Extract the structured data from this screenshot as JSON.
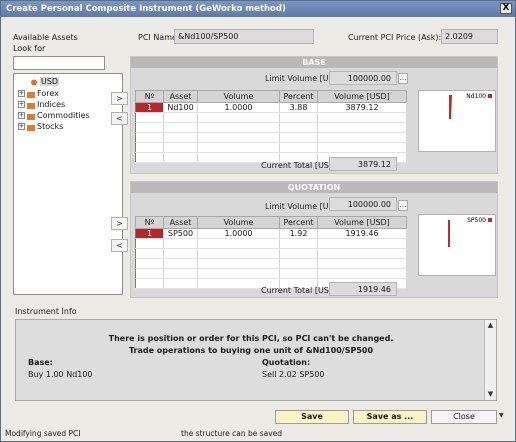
{
  "window": {
    "title": "Create Personal Composite Instrument (GeWorko method)",
    "close_glyph": "X"
  },
  "left": {
    "available_assets_label": "Available Assets",
    "look_for_label": "Look for",
    "search_value": "",
    "tree": [
      {
        "label": "USD",
        "selected": true,
        "expandable": false
      },
      {
        "label": "Forex",
        "expandable": true
      },
      {
        "label": "Indices",
        "expandable": true
      },
      {
        "label": "Commodities",
        "expandable": true
      },
      {
        "label": "Stocks",
        "expandable": true
      }
    ]
  },
  "header": {
    "pci_name_label": "PCI Name:",
    "pci_name_value": "&Nd100/SP500",
    "price_label": "Current PCI Price (Ask):",
    "price_value": "2.0209"
  },
  "base": {
    "title": "BASE",
    "limit_label": "Limit Volume [USD]",
    "limit_value": "100000.00",
    "dots": "...",
    "columns": [
      "Nº",
      "Asset",
      "Volume",
      "Percent",
      "Volume [USD]"
    ],
    "rows": [
      {
        "num": "1",
        "asset": "Nd100",
        "volume": "1.0000",
        "percent": "3.88",
        "volume_usd": "3879.12"
      }
    ],
    "total_label": "Current Total [USD]",
    "total_value": "3879.12",
    "mini_label": "Nd100"
  },
  "quotation": {
    "title": "QUOTATION",
    "limit_label": "Limit Volume [USD]",
    "limit_value": "100000.00",
    "dots": "...",
    "columns": [
      "Nº",
      "Asset",
      "Volume",
      "Percent",
      "Volume [USD]"
    ],
    "rows": [
      {
        "num": "1",
        "asset": "SP500",
        "volume": "1.0000",
        "percent": "1.92",
        "volume_usd": "1919.46"
      }
    ],
    "total_label": "Current Total [USD]",
    "total_value": "1919.46",
    "mini_label": "SP500"
  },
  "side_buttons": {
    "add": ">",
    "remove": "<"
  },
  "info": {
    "section_label": "Instrument Info",
    "line1": "There is position or order for this PCI, so PCI can't be changed.",
    "line2": "Trade operations to buying one unit of &Nd100/SP500",
    "base_label": "Base:",
    "base_value": "Buy 1.00 Nd100",
    "quotation_label": "Quotation:",
    "quotation_value": "Sell 2.02 SP500"
  },
  "buttons": {
    "save": "Save",
    "save_as": "Save as ...",
    "close": "Close"
  },
  "status": {
    "left": "Modifying saved PCI",
    "middle": "the structure can be saved"
  },
  "colors": {
    "accent": "#b3282b",
    "title_bar": "#6b84b0",
    "highlight_button": "#fdf3c6"
  }
}
